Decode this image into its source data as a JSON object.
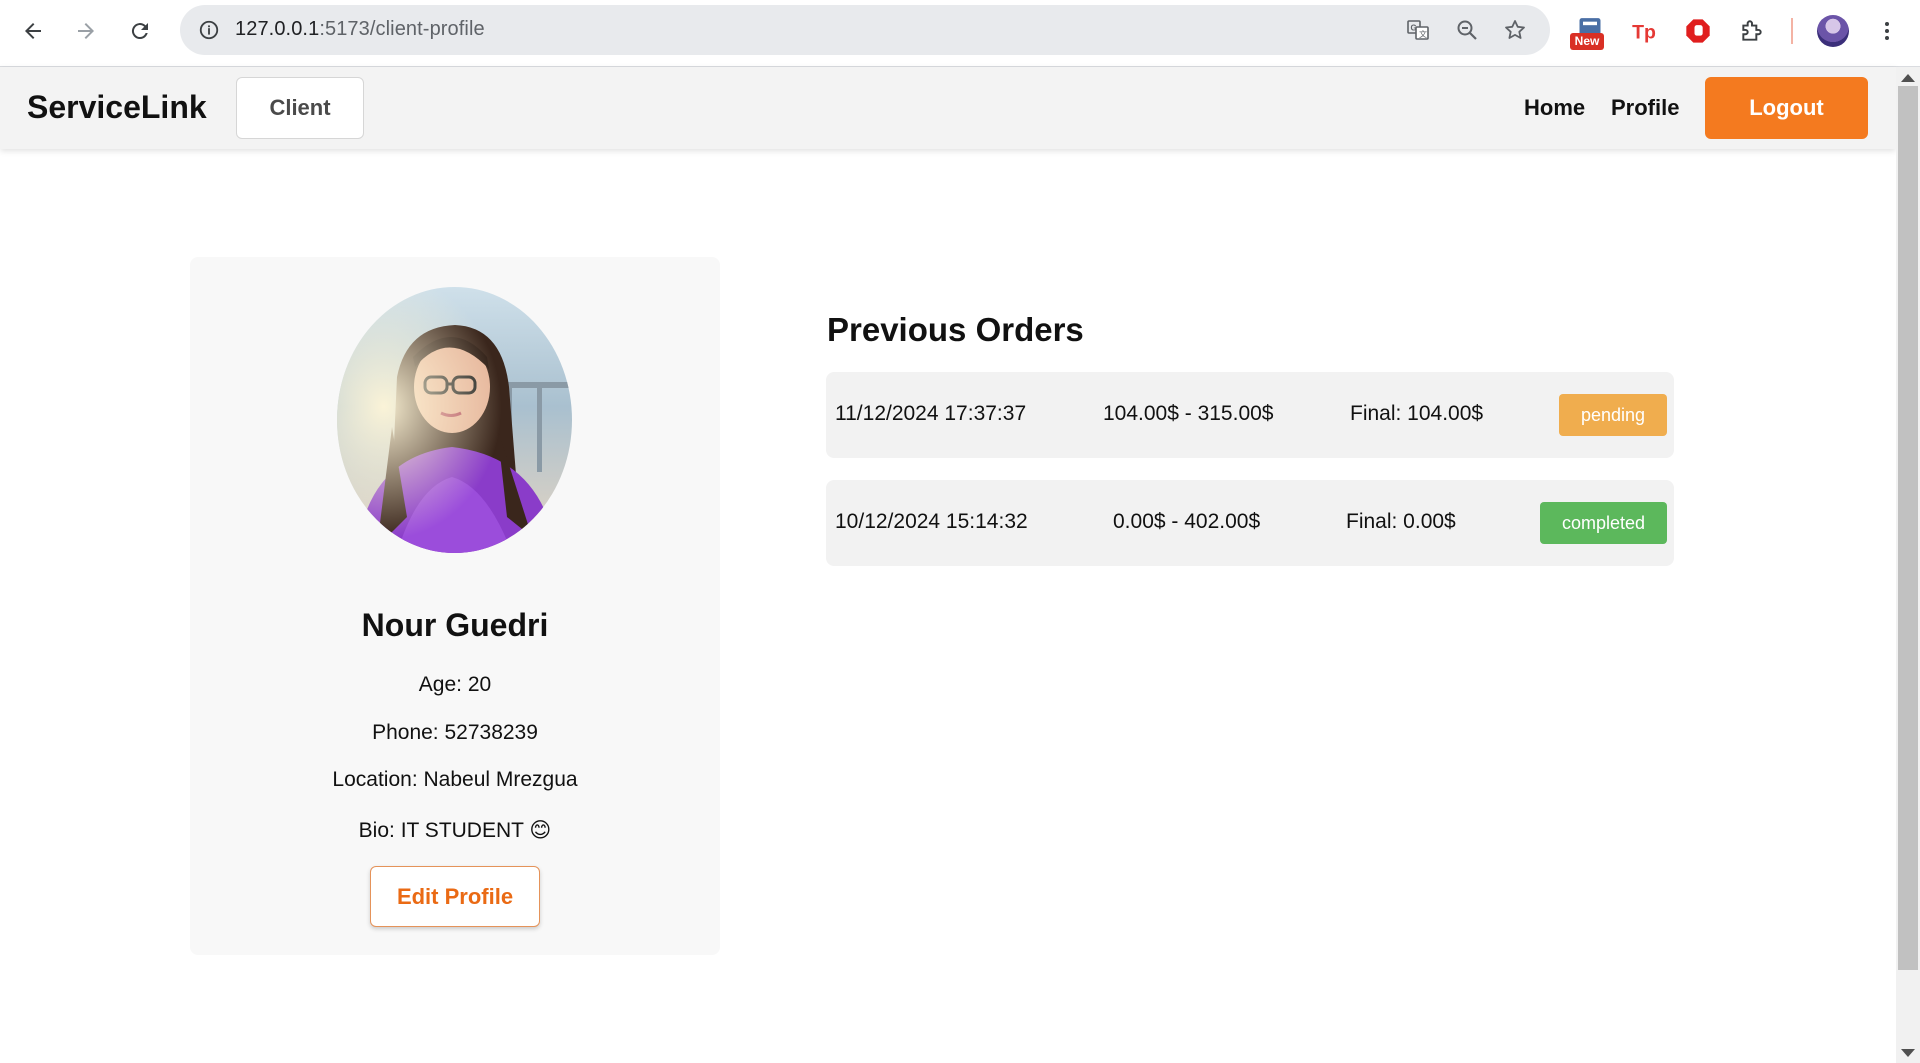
{
  "browser": {
    "url_host": "127.0.0.1",
    "url_path": ":5173/client-profile",
    "new_badge": "New",
    "icons": [
      "back-icon",
      "forward-icon",
      "reload-icon",
      "site-info-icon",
      "translate-icon",
      "zoom-out-icon",
      "bookmark-star-icon",
      "extension-news-icon",
      "extension-tp-icon",
      "extension-adblock-icon",
      "extensions-puzzle-icon",
      "profile-avatar-icon",
      "more-menu-icon"
    ]
  },
  "header": {
    "brand": "ServiceLink",
    "role": "Client",
    "nav": {
      "home": "Home",
      "profile": "Profile"
    },
    "logout": "Logout",
    "accent_color": "#f47a1f"
  },
  "profile": {
    "name": "Nour Guedri",
    "age": "Age: 20",
    "phone": "Phone: 52738239",
    "location": "Location: Nabeul Mrezgua",
    "bio": "Bio: IT STUDENT 😊",
    "edit_label": "Edit Profile"
  },
  "orders": {
    "title": "Previous Orders",
    "items": [
      {
        "date": "11/12/2024 17:37:37",
        "range": "104.00$ - 315.00$",
        "final": "Final: 104.00$",
        "status": "pending",
        "status_color": "#f0ad4e"
      },
      {
        "date": "10/12/2024 15:14:32",
        "range": "0.00$ - 402.00$",
        "final": "Final: 0.00$",
        "status": "completed",
        "status_color": "#5cb85c"
      }
    ]
  }
}
